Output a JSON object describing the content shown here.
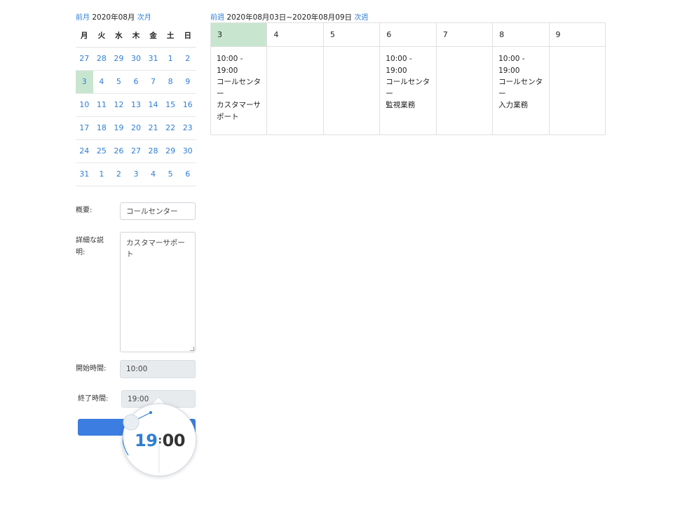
{
  "mini_calendar": {
    "prev_label": "前月",
    "month_label": "2020年08月",
    "next_label": "次月",
    "weekdays": [
      "月",
      "火",
      "水",
      "木",
      "金",
      "土",
      "日"
    ],
    "weeks": [
      [
        "27",
        "28",
        "29",
        "30",
        "31",
        "1",
        "2"
      ],
      [
        "3",
        "4",
        "5",
        "6",
        "7",
        "8",
        "9"
      ],
      [
        "10",
        "11",
        "12",
        "13",
        "14",
        "15",
        "16"
      ],
      [
        "17",
        "18",
        "19",
        "20",
        "21",
        "22",
        "23"
      ],
      [
        "24",
        "25",
        "26",
        "27",
        "28",
        "29",
        "30"
      ],
      [
        "31",
        "1",
        "2",
        "3",
        "4",
        "5",
        "6"
      ]
    ],
    "selected_day": "3"
  },
  "form": {
    "summary_label": "概要:",
    "summary_value": "コールセンター",
    "detail_label": "詳細な説明:",
    "detail_value": "カスタマーサポート",
    "start_label": "開始時間:",
    "start_value": "10:00",
    "end_label": "終了時間:",
    "end_value": "19:00"
  },
  "clock_picker": {
    "hours": "19",
    "separator": ":",
    "minutes": "00"
  },
  "week_view": {
    "prev_label": "前週",
    "range_label": "2020年08月03日~2020年08月09日",
    "next_label": "次週",
    "days": [
      "3",
      "4",
      "5",
      "6",
      "7",
      "8",
      "9"
    ],
    "today_index": 0,
    "events": [
      {
        "time": "10:00 -\n19:00",
        "title": "コールセンター",
        "detail": "カスタマーサポート"
      },
      null,
      null,
      {
        "time": "10:00 -\n19:00",
        "title": "コールセンター",
        "detail": "監視業務"
      },
      null,
      {
        "time": "10:00 -\n19:00",
        "title": "コールセンター",
        "detail": "入力業務"
      },
      null
    ]
  },
  "colors": {
    "accent": "#2f7fd4",
    "today": "#c8e6cf",
    "button": "#3b7de0"
  }
}
